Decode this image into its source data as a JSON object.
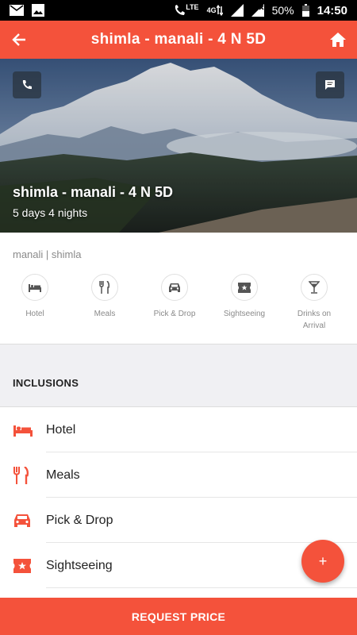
{
  "status_bar": {
    "battery": "50%",
    "time": "14:50",
    "network": "4G",
    "lte": "LTE"
  },
  "app_bar": {
    "title": "shimla - manali - 4 N 5D",
    "back_icon": "arrow-left-icon",
    "home_icon": "home-icon",
    "color": "#f4523b"
  },
  "hero": {
    "title": "shimla - manali - 4 N 5D",
    "subtitle": "5 days 4 nights",
    "call_icon": "phone-icon",
    "chat_icon": "chat-icon"
  },
  "summary": {
    "destinations": "manali | shimla",
    "amenities": [
      {
        "label": "Hotel",
        "icon": "bed-icon"
      },
      {
        "label": "Meals",
        "icon": "cutlery-icon"
      },
      {
        "label": "Pick & Drop",
        "icon": "car-icon"
      },
      {
        "label": "Sightseeing",
        "icon": "ticket-icon"
      },
      {
        "label": "Drinks on Arrival",
        "icon": "cocktail-icon"
      }
    ]
  },
  "inclusions": {
    "heading": "INCLUSIONS",
    "items": [
      {
        "label": "Hotel",
        "icon": "bed-icon"
      },
      {
        "label": "Meals",
        "icon": "cutlery-icon"
      },
      {
        "label": "Pick & Drop",
        "icon": "car-icon"
      },
      {
        "label": "Sightseeing",
        "icon": "ticket-icon"
      }
    ]
  },
  "fab": {
    "label": "+"
  },
  "cta": {
    "label": "REQUEST PRICE"
  }
}
